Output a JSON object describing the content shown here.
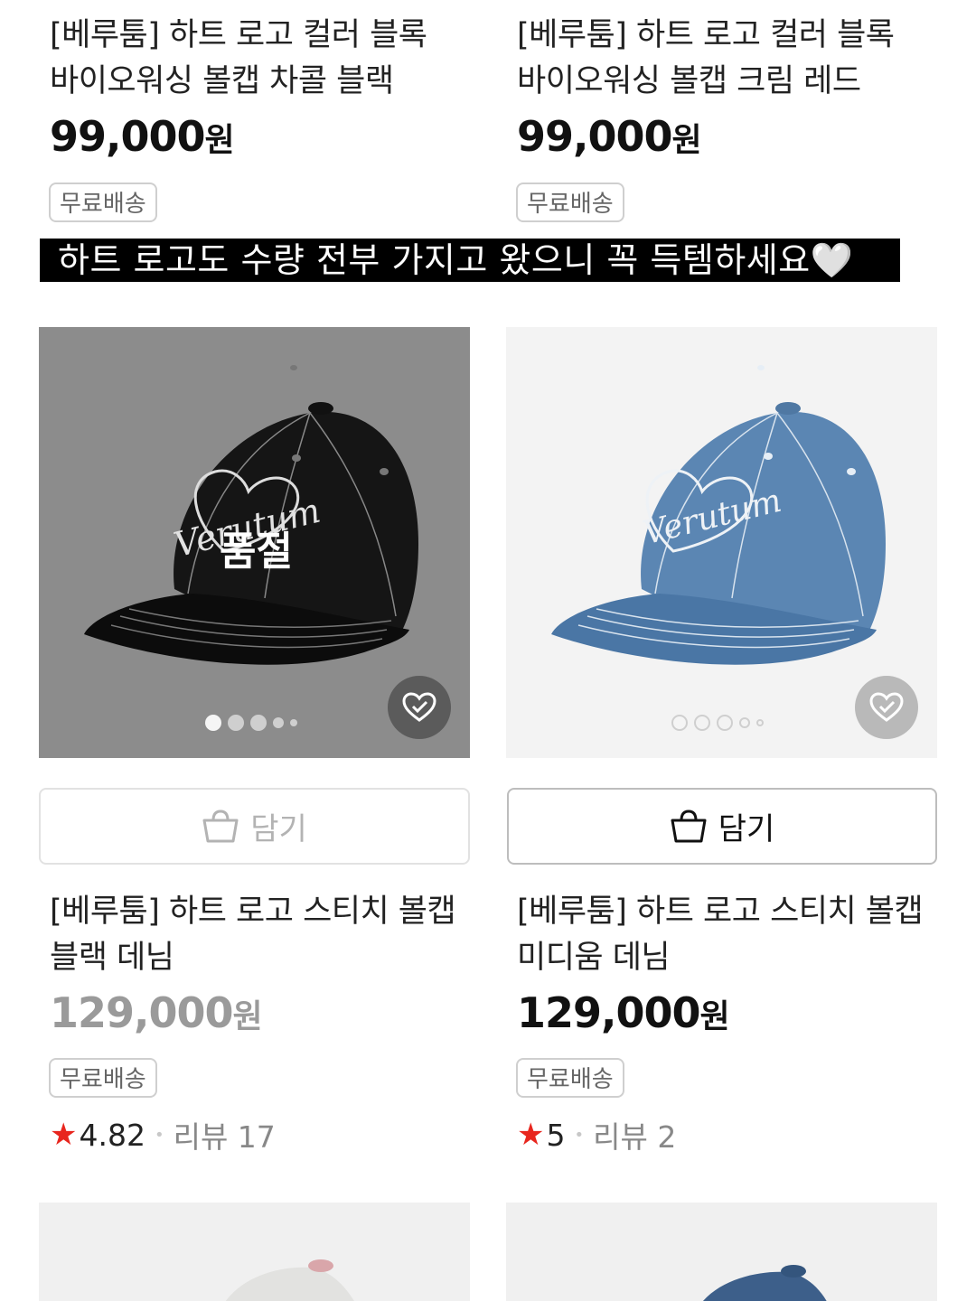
{
  "top_products": [
    {
      "title_line1": "[베루툼] 하트 로고 컬러 블록",
      "title_line2": "바이오워싱 볼캡 차콜 블랙",
      "price_number": "99,000",
      "price_unit": "원",
      "badge": "무료배송"
    },
    {
      "title_line1": "[베루툼] 하트 로고 컬러 블록",
      "title_line2": "바이오워싱 볼캡 크림 레드",
      "price_number": "99,000",
      "price_unit": "원",
      "badge": "무료배송"
    }
  ],
  "banner": {
    "text": "하트 로고도 수량 전부 가지고 왔으니 꼭 득템하세요🤍"
  },
  "products": [
    {
      "image_label": "품절",
      "image_text": "Verutum",
      "cart_label": "담기",
      "cart_enabled": false,
      "title_line1": "[베루툼] 하트 로고 스티치 볼캡",
      "title_line2": "블랙 데님",
      "price_number": "129,000",
      "price_unit": "원",
      "sold_out": true,
      "badge": "무료배송",
      "rating": "4.82",
      "review_label": "리뷰 17",
      "image_dots": {
        "count": 5,
        "active": 0
      }
    },
    {
      "image_label": "",
      "image_text": "Verutum",
      "cart_label": "담기",
      "cart_enabled": true,
      "title_line1": "[베루툼] 하트 로고 스티치 볼캡",
      "title_line2": "미디움 데님",
      "price_number": "129,000",
      "price_unit": "원",
      "sold_out": false,
      "badge": "무료배송",
      "rating": "5",
      "review_label": "리뷰 2",
      "image_dots": {
        "count": 5,
        "active": 0
      }
    }
  ],
  "colors": {
    "star": "#e8261e",
    "banner_bg": "#000000",
    "cap_black": "#151515",
    "cap_denim": "#5b86b3"
  },
  "icons": {
    "cart": "shopping-bag-icon",
    "wishlist": "heart-check-icon",
    "star": "star-icon"
  }
}
